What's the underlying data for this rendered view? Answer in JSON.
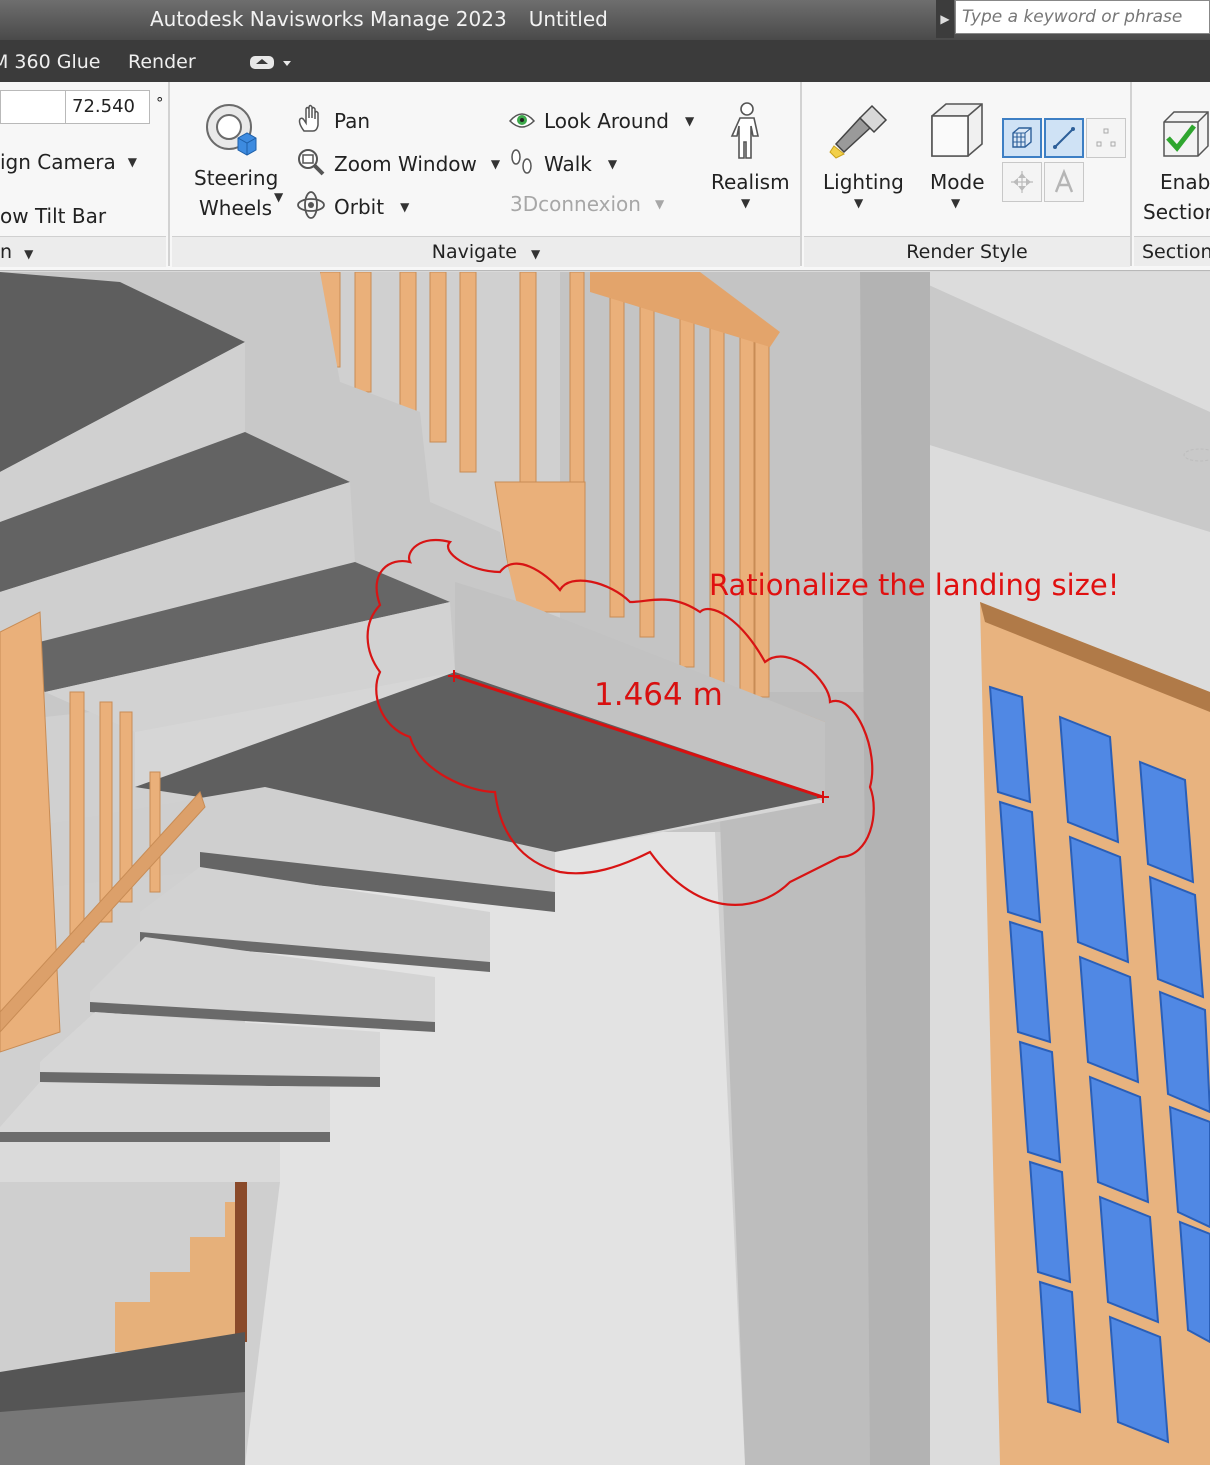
{
  "title_bar": {
    "app_name": "Autodesk Navisworks Manage 2023",
    "document": "Untitled",
    "search_placeholder": "Type a keyword or phrase"
  },
  "tabs": [
    "M 360 Glue",
    "Render"
  ],
  "ribbon": {
    "camera_panel": {
      "angle_value": "72.540",
      "degree_symbol": "°",
      "align_camera": "ign Camera",
      "show_tilt_bar": "ow Tilt Bar",
      "footer": "n"
    },
    "navigate_panel": {
      "steering_wheels_line1": "Steering",
      "steering_wheels_line2": "Wheels",
      "pan": "Pan",
      "zoom_window": "Zoom Window",
      "orbit": "Orbit",
      "look_around": "Look Around",
      "walk": "Walk",
      "threedconnexion": "3Dconnexion",
      "realism": "Realism",
      "footer": "Navigate"
    },
    "render_style_panel": {
      "lighting": "Lighting",
      "mode": "Mode",
      "footer": "Render Style"
    },
    "sectioning_panel": {
      "enable_line1": "Enabl",
      "enable_line2": "Section",
      "footer": "Section"
    }
  },
  "viewport": {
    "annotation_text": "Rationalize the landing size!",
    "measurement": "1.464 m",
    "annotation_color": "#e01010"
  }
}
